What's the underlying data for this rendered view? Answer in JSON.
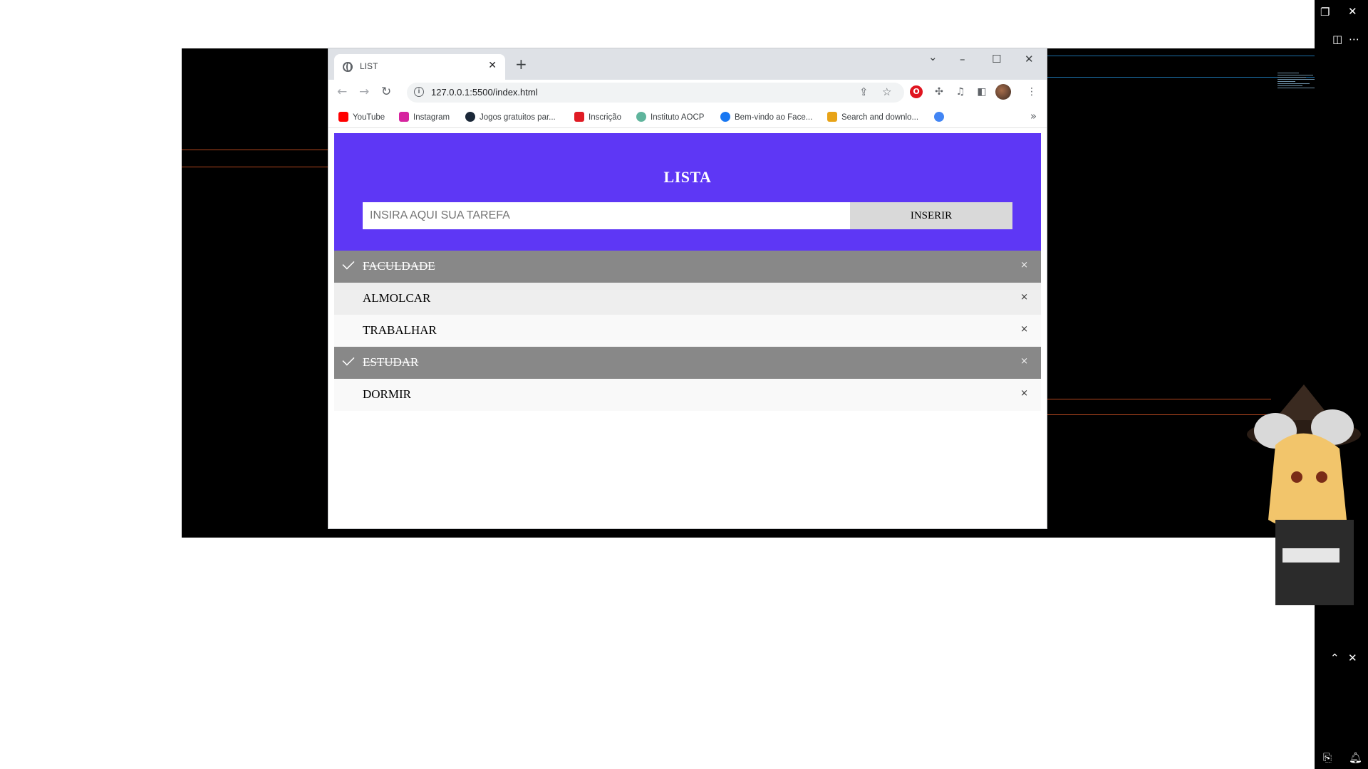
{
  "browser": {
    "tab_title": "LIST",
    "tab_close": "✕",
    "new_tab": "+",
    "window_controls": {
      "chevron": "⌄",
      "minimize": "–",
      "maximize": "☐",
      "close": "✕"
    },
    "url": "127.0.0.1:5500/index.html",
    "info_glyph": "i",
    "bookmarks": [
      {
        "label": "YouTube",
        "color": "#ff0000"
      },
      {
        "label": "Instagram",
        "color": "#d6249f"
      },
      {
        "label": "Jogos gratuitos par...",
        "color": "#1b2838"
      },
      {
        "label": "Inscrição",
        "color": "#e01b24"
      },
      {
        "label": "Instituto AOCP",
        "color": "#5fb49c"
      },
      {
        "label": "Bem-vindo ao Face...",
        "color": "#1877f2"
      },
      {
        "label": "Search and downlo...",
        "color": "#e8a317"
      },
      {
        "label": "",
        "color": "#4285f4"
      }
    ],
    "bookmarks_more": "»"
  },
  "app": {
    "title": "LISTA",
    "input_placeholder": "INSIRA AQUI SUA TAREFA",
    "add_button": "INSERIR",
    "accent_color": "#5e37f5",
    "tasks": [
      {
        "text": "FACULDADE",
        "checked": true
      },
      {
        "text": "ALMOLCAR",
        "checked": false
      },
      {
        "text": "TRABALHAR",
        "checked": false
      },
      {
        "text": "ESTUDAR",
        "checked": true
      },
      {
        "text": "DORMIR",
        "checked": false
      }
    ],
    "close_glyph": "×"
  }
}
